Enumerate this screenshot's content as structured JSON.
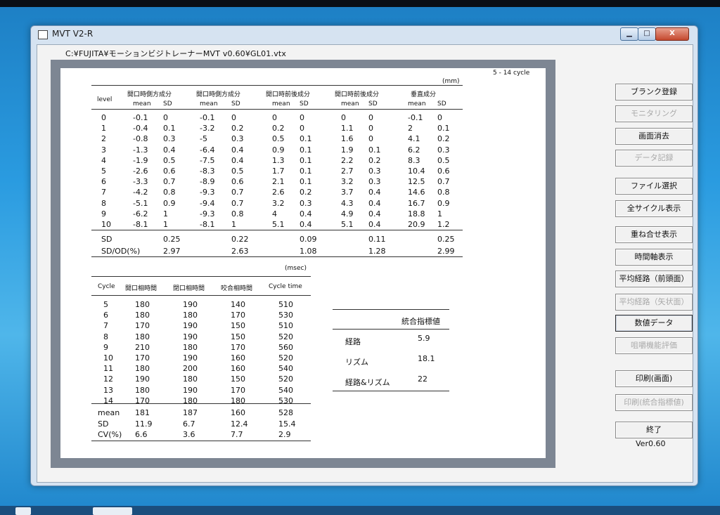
{
  "window": {
    "title": "MVT V2-R",
    "path": "C:¥FUJITA¥モーションビジトレーナーMVT  v0.60¥GL01.vtx",
    "controls": {
      "minimize": "▁",
      "maximize": "□",
      "close": "X"
    }
  },
  "report": {
    "cycle_range": "5 - 14 cycle",
    "level_table": {
      "unit": "(mm)",
      "level_header": "level",
      "groups": [
        "開口時側方成分",
        "開口時側方成分",
        "開口時前後成分",
        "開口時前後成分",
        "垂直成分"
      ],
      "sub": [
        "mean",
        "SD"
      ],
      "rows": [
        [
          "0",
          "-0.1",
          "0",
          "-0.1",
          "0",
          "0",
          "0",
          "0",
          "0",
          "-0.1",
          "0"
        ],
        [
          "1",
          "-0.4",
          "0.1",
          "-3.2",
          "0.2",
          "0.2",
          "0",
          "1.1",
          "0",
          "2",
          "0.1"
        ],
        [
          "2",
          "-0.8",
          "0.3",
          "-5",
          "0.3",
          "0.5",
          "0.1",
          "1.6",
          "0",
          "4.1",
          "0.2"
        ],
        [
          "3",
          "-1.3",
          "0.4",
          "-6.4",
          "0.4",
          "0.9",
          "0.1",
          "1.9",
          "0.1",
          "6.2",
          "0.3"
        ],
        [
          "4",
          "-1.9",
          "0.5",
          "-7.5",
          "0.4",
          "1.3",
          "0.1",
          "2.2",
          "0.2",
          "8.3",
          "0.5"
        ],
        [
          "5",
          "-2.6",
          "0.6",
          "-8.3",
          "0.5",
          "1.7",
          "0.1",
          "2.7",
          "0.3",
          "10.4",
          "0.6"
        ],
        [
          "6",
          "-3.3",
          "0.7",
          "-8.9",
          "0.6",
          "2.1",
          "0.1",
          "3.2",
          "0.3",
          "12.5",
          "0.7"
        ],
        [
          "7",
          "-4.2",
          "0.8",
          "-9.3",
          "0.7",
          "2.6",
          "0.2",
          "3.7",
          "0.4",
          "14.6",
          "0.8"
        ],
        [
          "8",
          "-5.1",
          "0.9",
          "-9.4",
          "0.7",
          "3.2",
          "0.3",
          "4.3",
          "0.4",
          "16.7",
          "0.9"
        ],
        [
          "9",
          "-6.2",
          "1",
          "-9.3",
          "0.8",
          "4",
          "0.4",
          "4.9",
          "0.4",
          "18.8",
          "1"
        ],
        [
          "10",
          "-8.1",
          "1",
          "-8.1",
          "1",
          "5.1",
          "0.4",
          "5.1",
          "0.4",
          "20.9",
          "1.2"
        ]
      ],
      "summary": [
        {
          "label": "SD",
          "values": [
            "0.25",
            "0.22",
            "0.09",
            "0.11",
            "0.25"
          ]
        },
        {
          "label": "SD/OD(%)",
          "values": [
            "2.97",
            "2.63",
            "1.08",
            "1.28",
            "2.99"
          ]
        }
      ]
    },
    "cycle_table": {
      "unit": "(msec)",
      "headers": [
        "Cycle",
        "開口相時間",
        "閉口相時間",
        "咬合相時間",
        "Cycle time"
      ],
      "rows": [
        [
          "5",
          "180",
          "190",
          "140",
          "510"
        ],
        [
          "6",
          "180",
          "180",
          "170",
          "530"
        ],
        [
          "7",
          "170",
          "190",
          "150",
          "510"
        ],
        [
          "8",
          "180",
          "190",
          "150",
          "520"
        ],
        [
          "9",
          "210",
          "180",
          "170",
          "560"
        ],
        [
          "10",
          "170",
          "190",
          "160",
          "520"
        ],
        [
          "11",
          "180",
          "200",
          "160",
          "540"
        ],
        [
          "12",
          "190",
          "180",
          "150",
          "520"
        ],
        [
          "13",
          "180",
          "190",
          "170",
          "540"
        ],
        [
          "14",
          "170",
          "180",
          "180",
          "530"
        ]
      ],
      "summary": [
        [
          "mean",
          "181",
          "187",
          "160",
          "528"
        ],
        [
          "SD",
          "11.9",
          "6.7",
          "12.4",
          "15.4"
        ],
        [
          "CV(%)",
          "6.6",
          "3.6",
          "7.7",
          "2.9"
        ]
      ]
    },
    "index_table": {
      "title": "統合指標値",
      "rows": [
        {
          "label": "経路",
          "value": "5.9"
        },
        {
          "label": "リズム",
          "value": "18.1"
        },
        {
          "label": "経路&リズム",
          "value": "22"
        }
      ]
    }
  },
  "sidebar": {
    "buttons": [
      {
        "label": "ブランク登録",
        "enabled": true
      },
      {
        "label": "モニタリング",
        "enabled": false
      },
      {
        "label": "画面消去",
        "enabled": true
      },
      {
        "label": "データ記録",
        "enabled": false
      },
      {
        "label": "ファイル選択",
        "enabled": true
      },
      {
        "label": "全サイクル表示",
        "enabled": true
      },
      {
        "label": "重ね合せ表示",
        "enabled": true
      },
      {
        "label": "時間軸表示",
        "enabled": true
      },
      {
        "label": "平均経路（前頭面）",
        "enabled": true
      },
      {
        "label": "平均経路（矢状面）",
        "enabled": false
      },
      {
        "label": "数値データ",
        "enabled": true,
        "active": true
      },
      {
        "label": "咀嚼機能評価",
        "enabled": false
      },
      {
        "label": "印刷(画面)",
        "enabled": true
      },
      {
        "label": "印刷(統合指標値)",
        "enabled": false
      },
      {
        "label": "終了",
        "enabled": true
      }
    ],
    "version": "Ver0.60"
  }
}
